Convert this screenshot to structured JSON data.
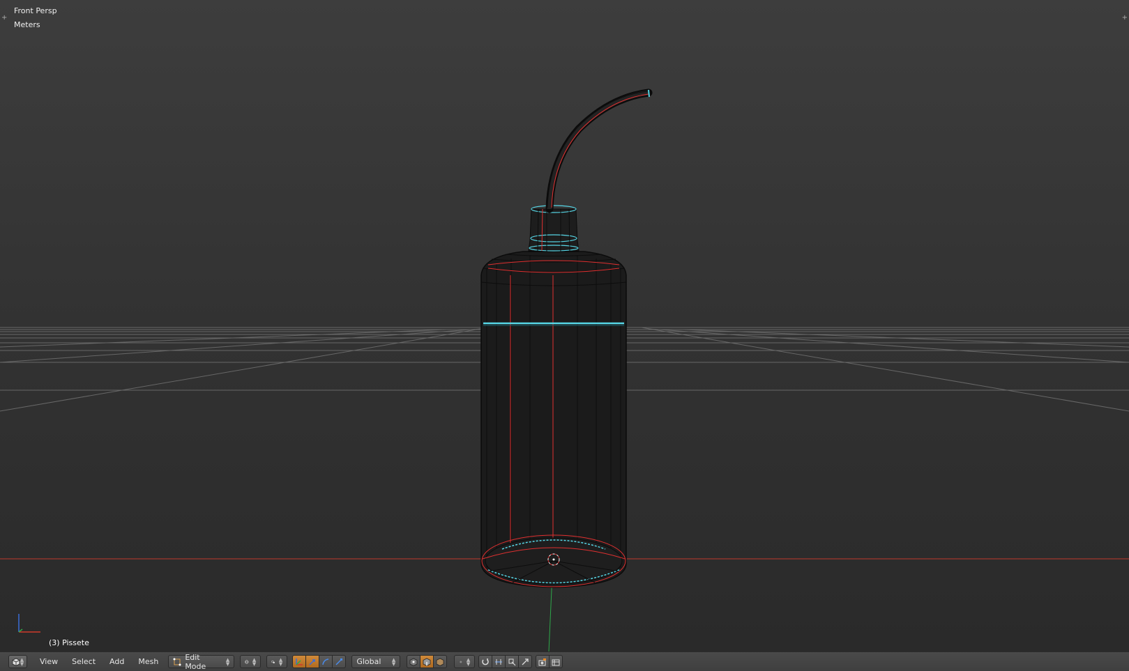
{
  "viewport": {
    "view_label": "Front Persp",
    "units_label": "Meters",
    "object_label": "(3) Pissete",
    "corner_plus": "+"
  },
  "header": {
    "menus": [
      "View",
      "Select",
      "Add",
      "Mesh"
    ],
    "mode": "Edit Mode",
    "orientation": "Global"
  },
  "colors": {
    "background": "#393939",
    "header": "#454545",
    "mesh_edge": "#0b0b0b",
    "seam": "#e03030",
    "selected_edge": "#56d6e6",
    "x_axis": "#c0392b",
    "y_axis": "#2ea84a",
    "active_button": "#c57c2e"
  },
  "icons": {
    "editor_type": "3d-view-icon",
    "mode": "edit-mode-icon",
    "shading": "sphere-shading-icon",
    "pivot": "pivot-point-icon",
    "manipulator": [
      "translate-icon",
      "rotate-icon",
      "scale-icon"
    ],
    "select_mode": [
      "vertex-select-icon",
      "edge-select-icon",
      "face-select-icon"
    ],
    "proportional": "proportional-edit-icon",
    "snap": [
      "snap-icon",
      "snap-target-icon",
      "snap-element-icon"
    ],
    "render": [
      "render-icon",
      "opengl-render-icon"
    ]
  }
}
